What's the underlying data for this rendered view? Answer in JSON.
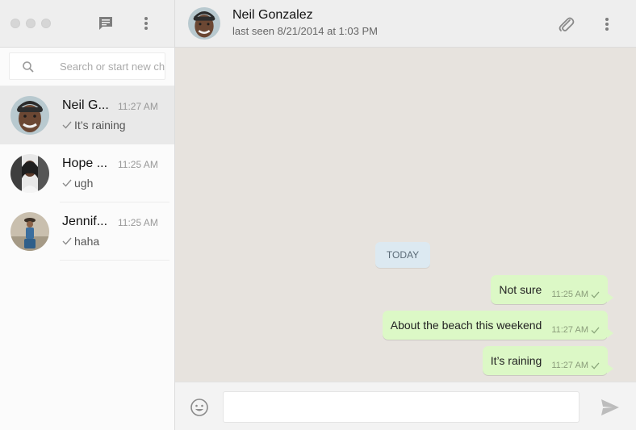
{
  "sidebar": {
    "search": {
      "placeholder": "Search or start new ch"
    },
    "chats": [
      {
        "name": "Neil G...",
        "time": "11:27 AM",
        "preview": "It’s raining"
      },
      {
        "name": "Hope ...",
        "time": "11:25 AM",
        "preview": "ugh"
      },
      {
        "name": "Jennif...",
        "time": "11:25 AM",
        "preview": "haha"
      }
    ]
  },
  "header": {
    "contact_name": "Neil Gonzalez",
    "last_seen": "last seen 8/21/2014 at 1:03 PM"
  },
  "conversation": {
    "day_label": "TODAY",
    "messages": [
      {
        "text": "Not sure",
        "time": "11:25 AM"
      },
      {
        "text": "About the beach this weekend",
        "time": "11:27 AM"
      },
      {
        "text": "It’s raining",
        "time": "11:27 AM"
      }
    ]
  },
  "colors": {
    "sent_bubble": "#dcf8c6",
    "conversation_bg": "#e7e3de",
    "day_badge": "#dce9f1"
  },
  "icons": {
    "new_chat": "chat-icon",
    "menu": "more-vertical-icon",
    "search": "search-icon",
    "attach": "paperclip-icon",
    "emoji": "emoji-icon",
    "send": "send-icon",
    "check": "check-icon"
  }
}
